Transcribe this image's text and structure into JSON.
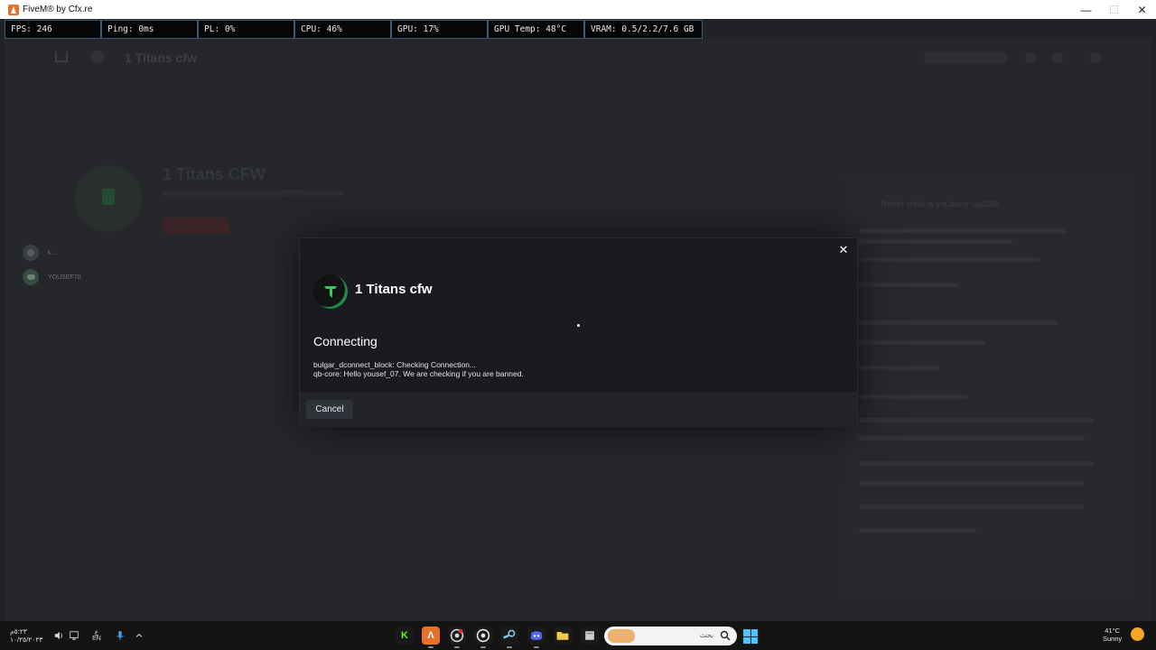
{
  "window": {
    "title": "FiveM® by Cfx.re",
    "controls": {
      "minimize": "—",
      "maximize": "☐",
      "close": "✕"
    }
  },
  "perf_overlay": [
    {
      "label": "FPS: 246"
    },
    {
      "label": "Ping: 0ms"
    },
    {
      "label": "PL: 0%"
    },
    {
      "label": "CPU: 46%"
    },
    {
      "label": "GPU: 17%"
    },
    {
      "label": "GPU Temp: 48°C"
    },
    {
      "label": "VRAM: 0.5/2.2/7.6 GB"
    }
  ],
  "background": {
    "nav_title": "1 Titans cfw",
    "hero_title": "1 Titans CFW",
    "players": [
      {
        "name": "k..."
      },
      {
        "name": "YOUSEF70"
      }
    ],
    "panel_title": "Never miss a vacancy update"
  },
  "modal": {
    "server_name": "1 Titans cfw",
    "status_title": "Connecting",
    "status_lines": [
      "bulgar_dconnect_block: Checking Connection...",
      "qb-core: Hello yousef_07. We are checking if you are banned."
    ],
    "cancel_label": "Cancel",
    "close_icon": "close-icon",
    "accent_color": "#1f8a49"
  },
  "taskbar": {
    "clock_time": "٥:٢٣م",
    "clock_date": "١٠/٢٥/٢٠٢٣",
    "lang": "ع",
    "lang_sub": "EN",
    "search_text": "بحث",
    "weather_temp": "41°C",
    "weather_desc": "Sunny",
    "apps": [
      "k-icon",
      "fivem-icon",
      "chrome-icon",
      "obs-icon",
      "steam-icon",
      "discord-icon",
      "folder-icon",
      "app-icon"
    ]
  }
}
